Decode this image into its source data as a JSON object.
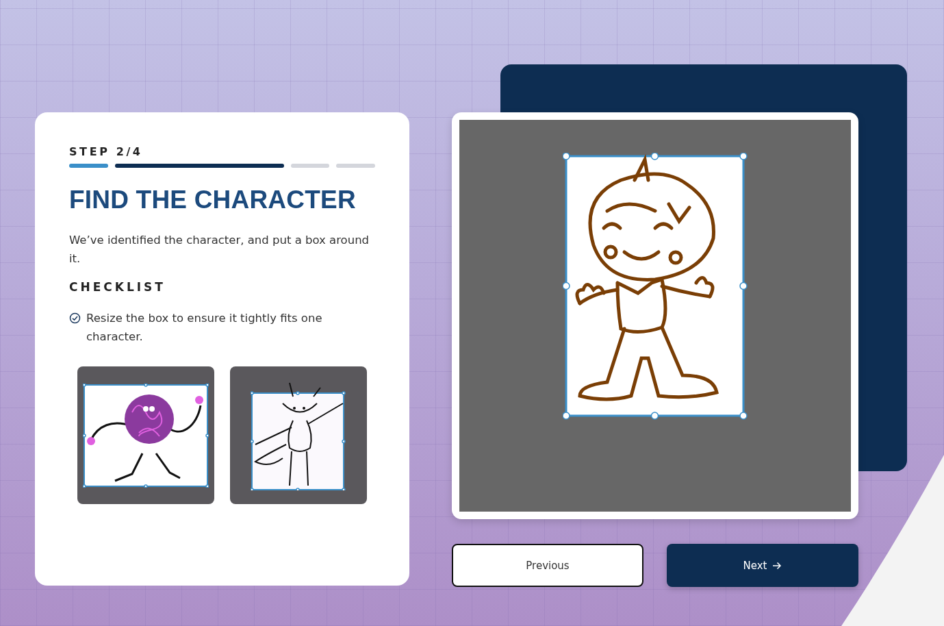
{
  "step": {
    "label": "STEP 2/4"
  },
  "progress": [
    {
      "selected": false,
      "done": true
    },
    {
      "selected": true,
      "done": false
    },
    {
      "selected": false,
      "done": false
    },
    {
      "selected": false,
      "done": false
    }
  ],
  "title": "FIND THE CHARACTER",
  "description": "We’ve identified the character, and put a box around it.",
  "checklist": {
    "heading": "CHECKLIST",
    "items": [
      {
        "text": "Resize the box to ensure it tightly fits one character.",
        "checked": true
      }
    ]
  },
  "examples": [
    {
      "kind": "blob"
    },
    {
      "kind": "fox"
    }
  ],
  "canvas": {
    "kind": "kid"
  },
  "buttons": {
    "previous": "Previous",
    "next": "Next"
  }
}
